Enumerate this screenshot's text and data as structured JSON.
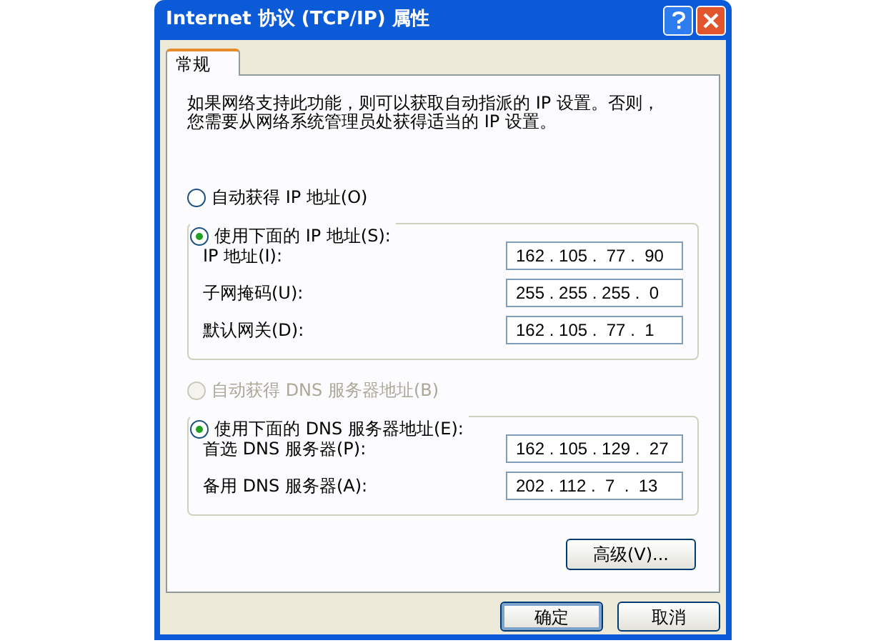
{
  "window": {
    "title": "Internet 协议 (TCP/IP) 属性"
  },
  "tabs": [
    {
      "label": "常规",
      "selected": true
    }
  ],
  "intro": "如果网络支持此功能，则可以获取自动指派的 IP 设置。否则，您需要从网络系统管理员处获得适当的 IP 设置。",
  "ip_section": {
    "radios": [
      {
        "label": "自动获得 IP 地址(O)",
        "selected": false,
        "disabled": false
      },
      {
        "label": "使用下面的 IP 地址(S):",
        "selected": true,
        "disabled": false
      }
    ],
    "fields": [
      {
        "label": "IP 地址(I):",
        "value": "162 . 105 .  77 .  90"
      },
      {
        "label": "子网掩码(U):",
        "value": "255 . 255 . 255 .  0"
      },
      {
        "label": "默认网关(D):",
        "value": "162 . 105 .  77 .  1"
      }
    ]
  },
  "dns_section": {
    "radios": [
      {
        "label": "自动获得 DNS 服务器地址(B)",
        "selected": false,
        "disabled": true
      },
      {
        "label": "使用下面的 DNS 服务器地址(E):",
        "selected": true,
        "disabled": false
      }
    ],
    "fields": [
      {
        "label": "首选 DNS 服务器(P):",
        "value": "162 . 105 . 129 .  27"
      },
      {
        "label": "备用 DNS 服务器(A):",
        "value": "202 . 112 .  7  .  13"
      }
    ]
  },
  "advanced_button": "高级(V)...",
  "buttons": [
    {
      "label": "确定",
      "default": true
    },
    {
      "label": "取消",
      "default": false
    }
  ]
}
